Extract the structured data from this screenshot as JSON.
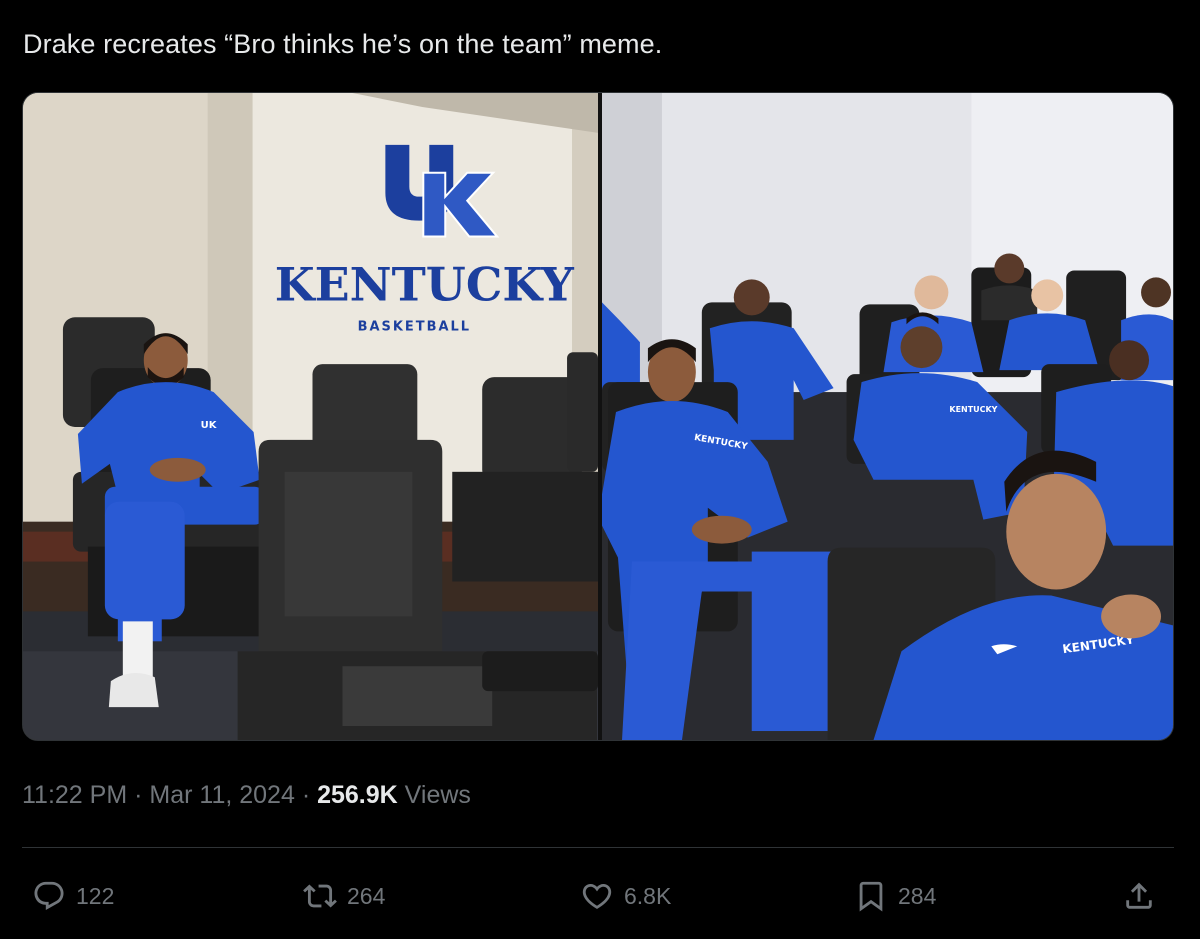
{
  "tweet": {
    "text": "Drake recreates “Bro thinks he’s on the team” meme."
  },
  "media": {
    "left_photo": {
      "logo_letters": "UK",
      "wall_title": "KENTUCKY",
      "wall_subtitle": "BASKETBALL",
      "jacket_text": "UK"
    },
    "right_photo": {
      "jacket_text": "KENTUCKY"
    }
  },
  "meta": {
    "time": "11:22 PM",
    "separator": "·",
    "date": "Mar 11, 2024",
    "views_count": "256.9K",
    "views_label": "Views"
  },
  "actions": {
    "replies": "122",
    "reposts": "264",
    "likes": "6.8K",
    "bookmarks": "284"
  },
  "colors": {
    "background": "#000000",
    "text": "#e7e9ea",
    "muted": "#71767b",
    "divider": "#2f3336",
    "kentucky_blue": "#1f4fbf"
  },
  "icons": [
    "reply-icon",
    "repost-icon",
    "like-icon",
    "bookmark-icon",
    "share-icon"
  ]
}
